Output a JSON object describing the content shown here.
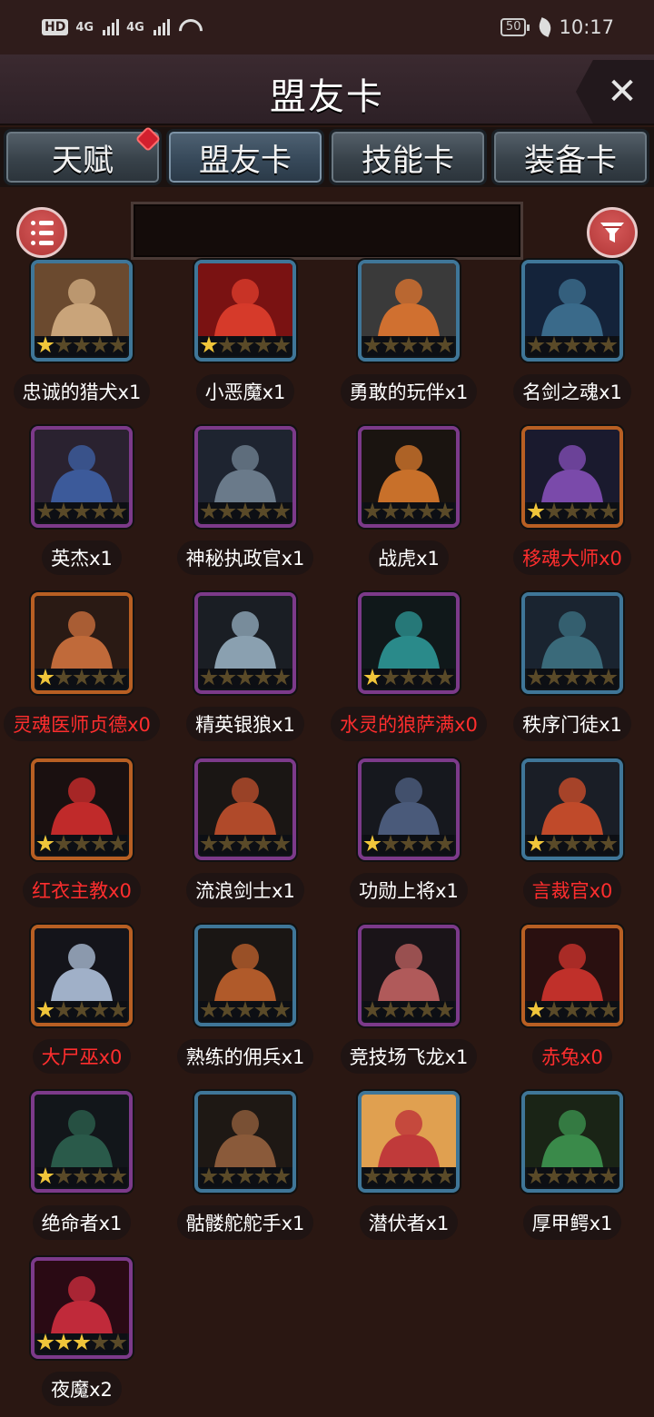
{
  "status_bar": {
    "hd": "HD",
    "sig1": "4G",
    "sig2": "4G",
    "battery": "50",
    "time": "10:17"
  },
  "header": {
    "title": "盟友卡",
    "close": "✕"
  },
  "tabs": [
    {
      "label": "天赋",
      "active": false,
      "dot": true
    },
    {
      "label": "盟友卡",
      "active": true,
      "dot": false
    },
    {
      "label": "技能卡",
      "active": false,
      "dot": false
    },
    {
      "label": "装备卡",
      "active": false,
      "dot": false
    }
  ],
  "search": {
    "value": "",
    "placeholder": ""
  },
  "colors": {
    "owned": "#ffffff",
    "missing": "#ff2e2e",
    "star_on": "#f0c53a",
    "star_off": "#5a4a28"
  },
  "cards": [
    {
      "name": "忠诚的猎犬x1",
      "stars": 1,
      "frame": "blue",
      "owned": true,
      "icon": "hound-icon",
      "art": [
        "#6b4a2f",
        "#c9a47a"
      ]
    },
    {
      "name": "小恶魔x1",
      "stars": 1,
      "frame": "blue",
      "owned": true,
      "icon": "imp-icon",
      "art": [
        "#7a1212",
        "#d63a2a"
      ]
    },
    {
      "name": "勇敢的玩伴x1",
      "stars": 0,
      "frame": "blue",
      "owned": true,
      "icon": "brave-companion-icon",
      "art": [
        "#3a3a3a",
        "#d07030"
      ]
    },
    {
      "name": "名剑之魂x1",
      "stars": 0,
      "frame": "blue",
      "owned": true,
      "icon": "sword-soul-icon",
      "art": [
        "#14233a",
        "#3a6a8a"
      ]
    },
    {
      "name": "英杰x1",
      "stars": 0,
      "frame": "purple",
      "owned": true,
      "icon": "hero-icon",
      "art": [
        "#2a2230",
        "#3c5a9a"
      ]
    },
    {
      "name": "神秘执政官x1",
      "stars": 0,
      "frame": "purple",
      "owned": true,
      "icon": "archon-icon",
      "art": [
        "#1e2430",
        "#6a7a8a"
      ]
    },
    {
      "name": "战虎x1",
      "stars": 0,
      "frame": "purple",
      "owned": true,
      "icon": "tiger-icon",
      "art": [
        "#1a1410",
        "#c8702a"
      ]
    },
    {
      "name": "移魂大师x0",
      "stars": 1,
      "frame": "orange",
      "owned": false,
      "icon": "soul-master-icon",
      "art": [
        "#1a1a2e",
        "#7a4aaa"
      ]
    },
    {
      "name": "灵魂医师贞德x0",
      "stars": 1,
      "frame": "orange",
      "owned": false,
      "icon": "joan-icon",
      "art": [
        "#2a1a14",
        "#c06a3a"
      ]
    },
    {
      "name": "精英银狼x1",
      "stars": 0,
      "frame": "purple",
      "owned": true,
      "icon": "silver-wolf-icon",
      "art": [
        "#1a1e24",
        "#8aa0b0"
      ]
    },
    {
      "name": "水灵的狼萨满x0",
      "stars": 1,
      "frame": "purple",
      "owned": false,
      "icon": "wolf-shaman-icon",
      "art": [
        "#10181a",
        "#2a8a8a"
      ]
    },
    {
      "name": "秩序门徒x1",
      "stars": 0,
      "frame": "blue",
      "owned": true,
      "icon": "order-disciple-icon",
      "art": [
        "#1a2430",
        "#3a6a7a"
      ]
    },
    {
      "name": "红衣主教x0",
      "stars": 1,
      "frame": "orange",
      "owned": false,
      "icon": "cardinal-icon",
      "art": [
        "#1a1010",
        "#c02a2a"
      ]
    },
    {
      "name": "流浪剑士x1",
      "stars": 0,
      "frame": "purple",
      "owned": true,
      "icon": "wandering-swordsman-icon",
      "art": [
        "#1a1614",
        "#b04a2a"
      ]
    },
    {
      "name": "功勋上将x1",
      "stars": 1,
      "frame": "purple",
      "owned": true,
      "icon": "general-icon",
      "art": [
        "#16181e",
        "#4a5a7a"
      ]
    },
    {
      "name": "言裁官x0",
      "stars": 1,
      "frame": "blue",
      "owned": false,
      "icon": "judge-icon",
      "art": [
        "#1a1e26",
        "#c04a2a"
      ]
    },
    {
      "name": "大尸巫x0",
      "stars": 1,
      "frame": "orange",
      "owned": false,
      "icon": "lich-icon",
      "art": [
        "#14141a",
        "#a0b0c8"
      ]
    },
    {
      "name": "熟练的佣兵x1",
      "stars": 0,
      "frame": "blue",
      "owned": true,
      "icon": "mercenary-icon",
      "art": [
        "#1a1614",
        "#b05a2a"
      ]
    },
    {
      "name": "竞技场飞龙x1",
      "stars": 0,
      "frame": "purple",
      "owned": true,
      "icon": "arena-wyvern-icon",
      "art": [
        "#1a1418",
        "#b05a5a"
      ]
    },
    {
      "name": "赤兔x0",
      "stars": 1,
      "frame": "orange",
      "owned": false,
      "icon": "red-hare-icon",
      "art": [
        "#2a1010",
        "#c0302a"
      ]
    },
    {
      "name": "绝命者x1",
      "stars": 1,
      "frame": "purple",
      "owned": true,
      "icon": "assassin-icon",
      "art": [
        "#12161a",
        "#2a5a4a"
      ]
    },
    {
      "name": "骷髅舵舵手x1",
      "stars": 0,
      "frame": "blue",
      "owned": true,
      "icon": "helmsman-icon",
      "art": [
        "#1e1814",
        "#8a5a3a"
      ]
    },
    {
      "name": "潜伏者x1",
      "stars": 0,
      "frame": "blue",
      "owned": true,
      "icon": "lurker-icon",
      "art": [
        "#e0a050",
        "#c03a3a"
      ]
    },
    {
      "name": "厚甲鳄x1",
      "stars": 0,
      "frame": "blue",
      "owned": true,
      "icon": "crocodile-icon",
      "art": [
        "#1a2416",
        "#3a8a4a"
      ]
    },
    {
      "name": "夜魔x2",
      "stars": 3,
      "frame": "purple",
      "owned": true,
      "icon": "night-demon-icon",
      "art": [
        "#2a0a14",
        "#c02a3a"
      ]
    }
  ]
}
